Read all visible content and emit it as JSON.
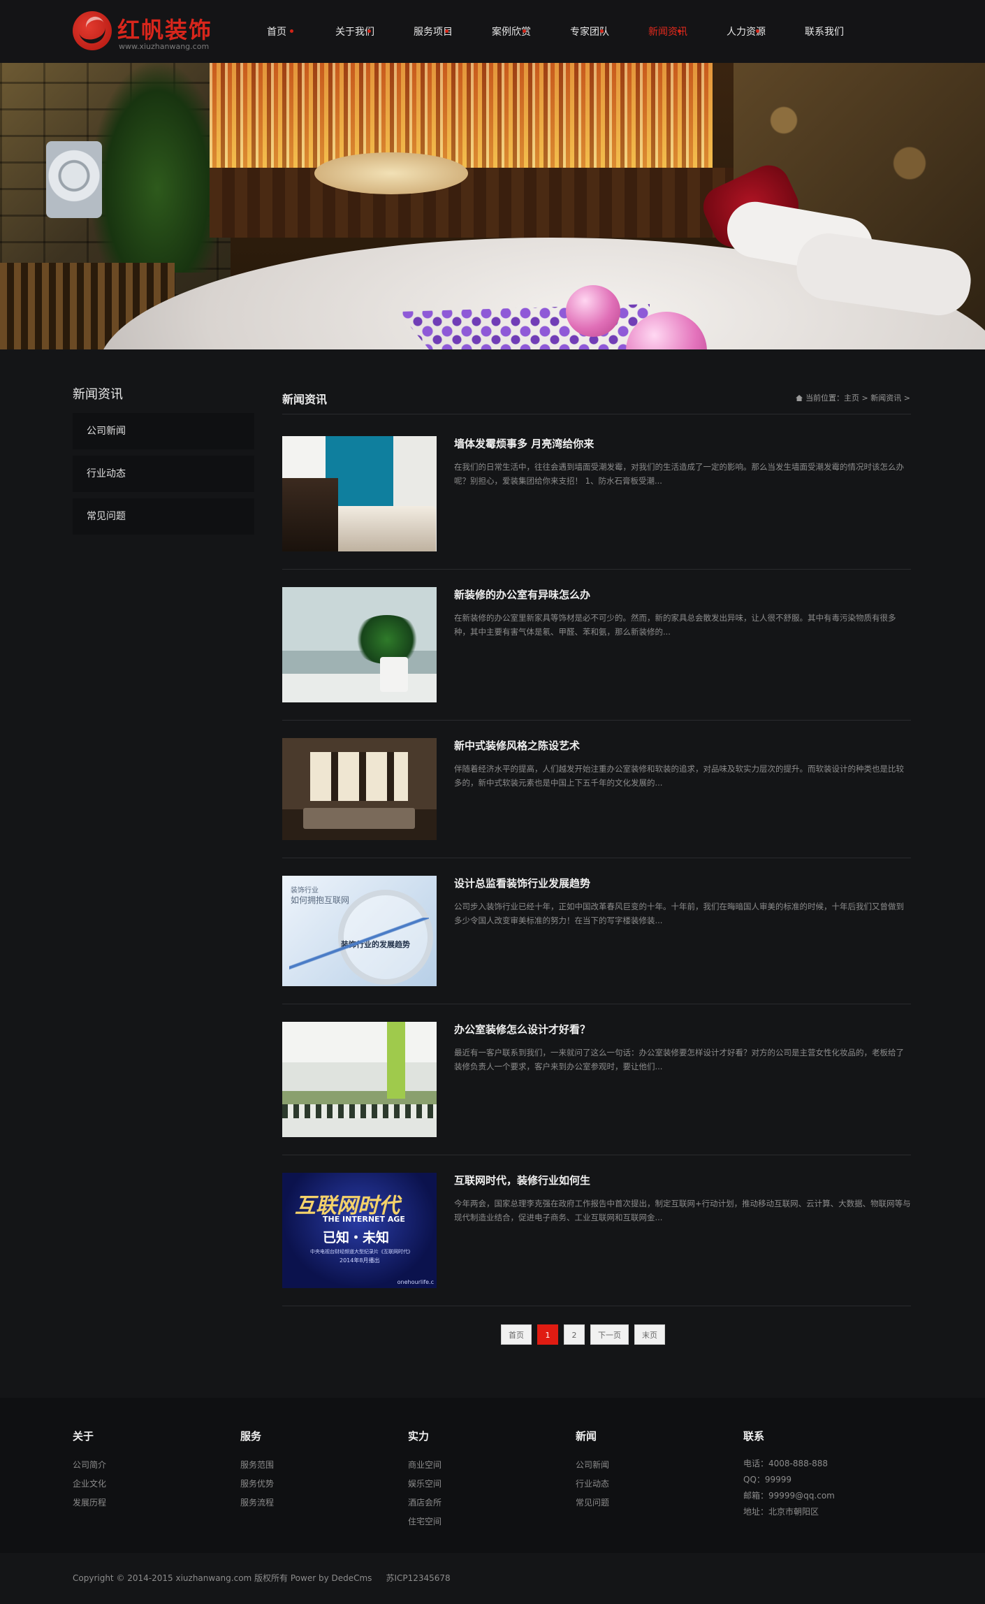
{
  "header": {
    "logo_title": "红帆装饰",
    "logo_sub": "www.xiuzhanwang.com",
    "nav": [
      {
        "label": "首页",
        "active": false
      },
      {
        "label": "关于我们",
        "active": false
      },
      {
        "label": "服务项目",
        "active": false
      },
      {
        "label": "案例欣赏",
        "active": false
      },
      {
        "label": "专家团队",
        "active": false
      },
      {
        "label": "新闻资讯",
        "active": true
      },
      {
        "label": "人力资源",
        "active": false
      },
      {
        "label": "联系我们",
        "active": false
      }
    ]
  },
  "sidebar": {
    "title": "新闻资讯",
    "items": [
      {
        "label": "公司新闻"
      },
      {
        "label": "行业动态"
      },
      {
        "label": "常见问题"
      }
    ]
  },
  "main": {
    "title": "新闻资讯",
    "breadcrumb": "当前位置：主页 > 新闻资讯 >",
    "articles": [
      {
        "title": "墙体发霉烦事多 月亮湾给你来",
        "desc": "在我们的日常生活中，往往会遇到墙面受潮发霉，对我们的生活造成了一定的影响。那么当发生墙面受潮发霉的情况时该怎么办呢？别担心，爱装集团给你来支招！ 1、防水石膏板受潮..."
      },
      {
        "title": "新装修的办公室有异味怎么办",
        "desc": "在新装修的办公室里新家具等饰材是必不可少的。然而，新的家具总会散发出异味，让人很不舒服。其中有毒污染物质有很多种，其中主要有害气体是氡、甲醛、苯和氨，那么新装修的..."
      },
      {
        "title": "新中式装修风格之陈设艺术",
        "desc": "伴随着经济水平的提高，人们越发开始注重办公室装修和软装的追求，对品味及软实力层次的提升。而软装设计的种类也是比较多的，新中式软装元素也是中国上下五千年的文化发展的..."
      },
      {
        "title": "设计总监看装饰行业发展趋势",
        "desc": "公司步入装饰行业已经十年，正如中国改革春风巨变的十年。十年前，我们在晦暗国人审美的标准的时候，十年后我们又曾做到多少令国人改变审美标准的努力！在当下的写字楼装修装...",
        "thumb_text": [
          "装饰行业",
          "如何拥抱互联网",
          "装饰行业的发展趋势"
        ]
      },
      {
        "title": "办公室装修怎么设计才好看？",
        "desc": "最近有一客户联系到我们，一来就问了这么一句话：办公室装修要怎样设计才好看？对方的公司是主营女性化妆品的，老板给了装修负责人一个要求，客户来到办公室参观时，要让他们..."
      },
      {
        "title": "互联网时代，装修行业如何生",
        "desc": "今年两会，国家总理李克强在政府工作报告中首次提出，制定互联网+行动计划，推动移动互联网、云计算、大数据、物联网等与现代制造业结合，促进电子商务、工业互联网和互联网金...",
        "thumb_text": [
          "互联网时代",
          "THE INTERNET AGE",
          "已知・未知",
          "中央电视台财经频道大型纪录片《互联网时代》",
          "2014年8月播出",
          "onehourlife.c"
        ]
      }
    ]
  },
  "pagination": [
    "首页",
    "1",
    "2",
    "下一页",
    "末页"
  ],
  "pagination_active": "1",
  "footer": {
    "columns": [
      {
        "head": "关于",
        "links": [
          "公司简介",
          "企业文化",
          "发展历程"
        ]
      },
      {
        "head": "服务",
        "links": [
          "服务范围",
          "服务优势",
          "服务流程"
        ]
      },
      {
        "head": "实力",
        "links": [
          "商业空间",
          "娱乐空间",
          "酒店会所",
          "住宅空间"
        ]
      },
      {
        "head": "新闻",
        "links": [
          "公司新闻",
          "行业动态",
          "常见问题"
        ]
      }
    ],
    "contact": {
      "head": "联系",
      "lines": [
        "电话：4008-888-888",
        "QQ：99999",
        "邮箱：99999@qq.com",
        "地址：北京市朝阳区"
      ]
    },
    "copyright": "Copyright © 2014-2015 xiuzhanwang.com 版权所有 Power by DedeCms",
    "icp": "苏ICP12345678"
  },
  "colors": {
    "accent": "#e01c12",
    "background": "#141517",
    "panel": "#0f1012"
  }
}
